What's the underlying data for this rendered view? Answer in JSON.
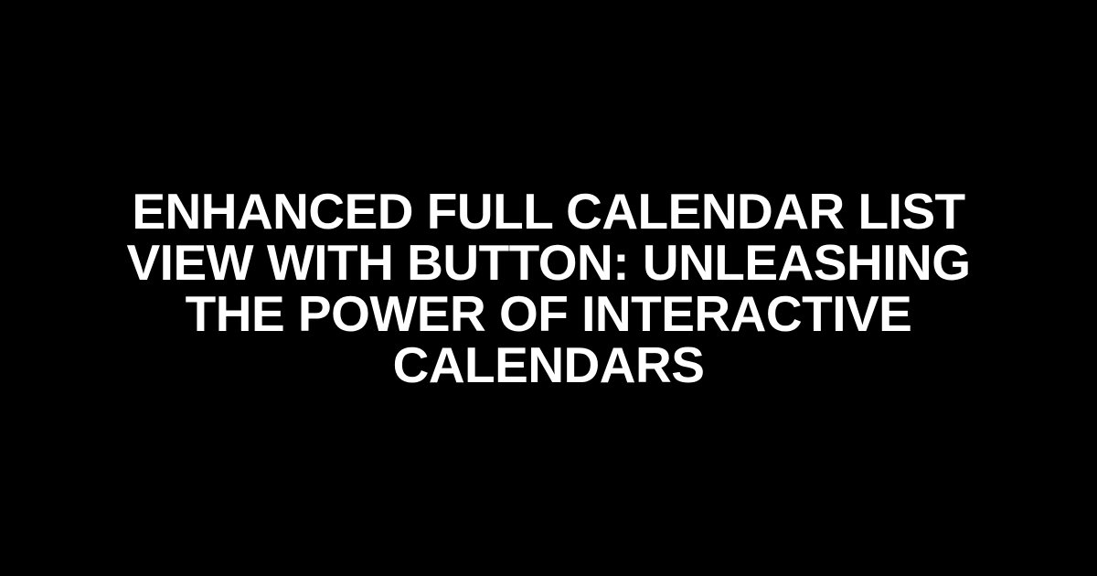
{
  "title": "Enhanced Full Calendar List View with Button: Unleashing the Power of Interactive Calendars"
}
